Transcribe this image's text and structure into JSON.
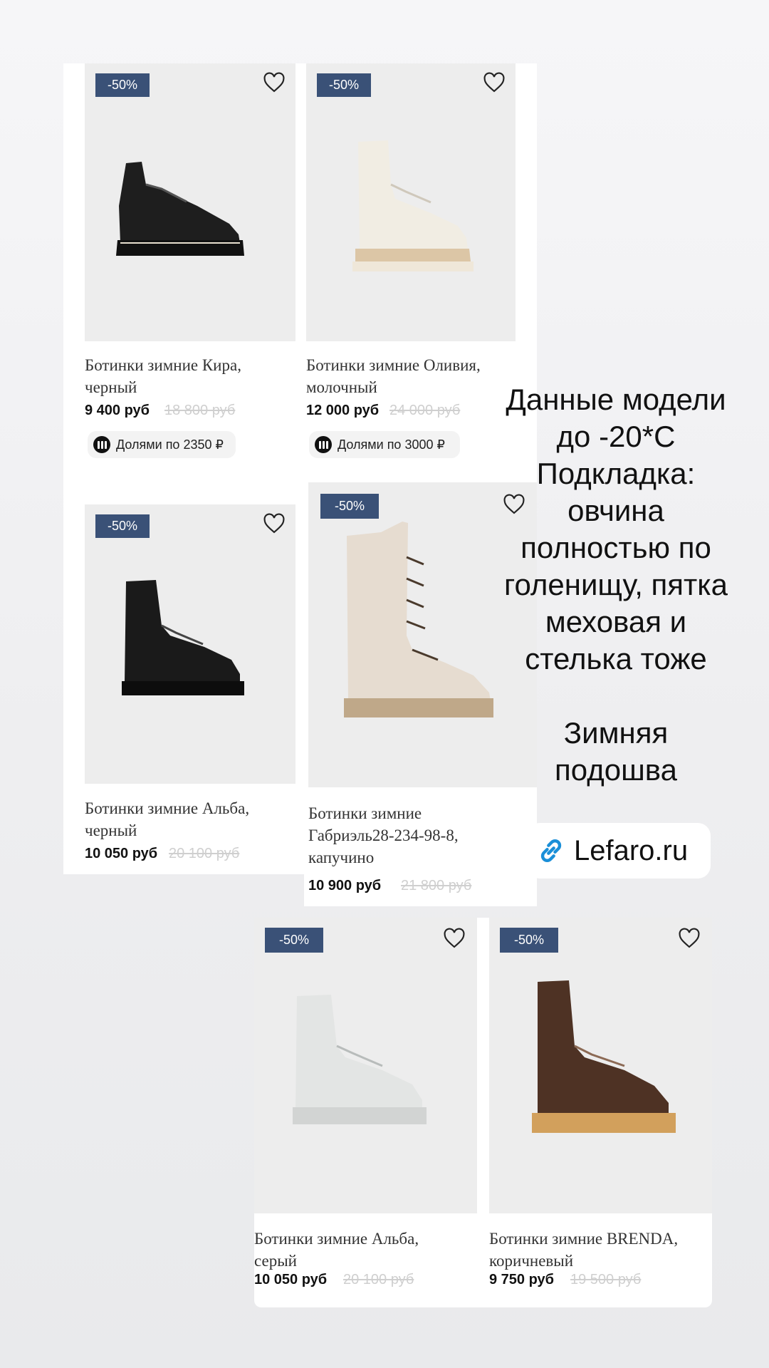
{
  "overlay": {
    "text": "Данные модели\nдо -20*С\nПодкладка:\nовчина\nполностью по\nголенищу, пятка\nмеховая и\nстелька тоже\n\nЗимняя\nподошва"
  },
  "link": {
    "text": "Lefaro.ru",
    "icon": "link-icon"
  },
  "products": [
    {
      "badge": "-50%",
      "name_line1": "Ботинки зимние Кира,",
      "name_line2": "черный",
      "price": "9 400 руб",
      "old_price": "18 800 руб",
      "installment": "Долями по 2350 ₽"
    },
    {
      "badge": "-50%",
      "name_line1": "Ботинки зимние Оливия,",
      "name_line2": "молочный",
      "price": "12 000 руб",
      "old_price": "24 000 руб",
      "installment": "Долями по 3000 ₽"
    },
    {
      "badge": "-50%",
      "name_line1": "Ботинки зимние Альба,",
      "name_line2": "черный",
      "price": "10 050 руб",
      "old_price": "20 100 руб"
    },
    {
      "badge": "-50%",
      "name_line1": "Ботинки зимние",
      "name_line2": "Габриэль28-234-98-8,",
      "name_line3": "капучино",
      "price": "10 900 руб",
      "old_price": "21 800 руб"
    },
    {
      "badge": "-50%",
      "name_line1": "Ботинки зимние Альба,",
      "name_line2": "серый",
      "price": "10 050 руб",
      "old_price": "20 100 руб"
    },
    {
      "badge": "-50%",
      "name_line1": "Ботинки зимние BRENDA,",
      "name_line2": "коричневый",
      "price": "9 750 руб",
      "old_price": "19 500 руб"
    }
  ],
  "colors": {
    "badge": "#3a5177",
    "image_bg": "#ededed",
    "old_price": "#cfcfcf"
  }
}
